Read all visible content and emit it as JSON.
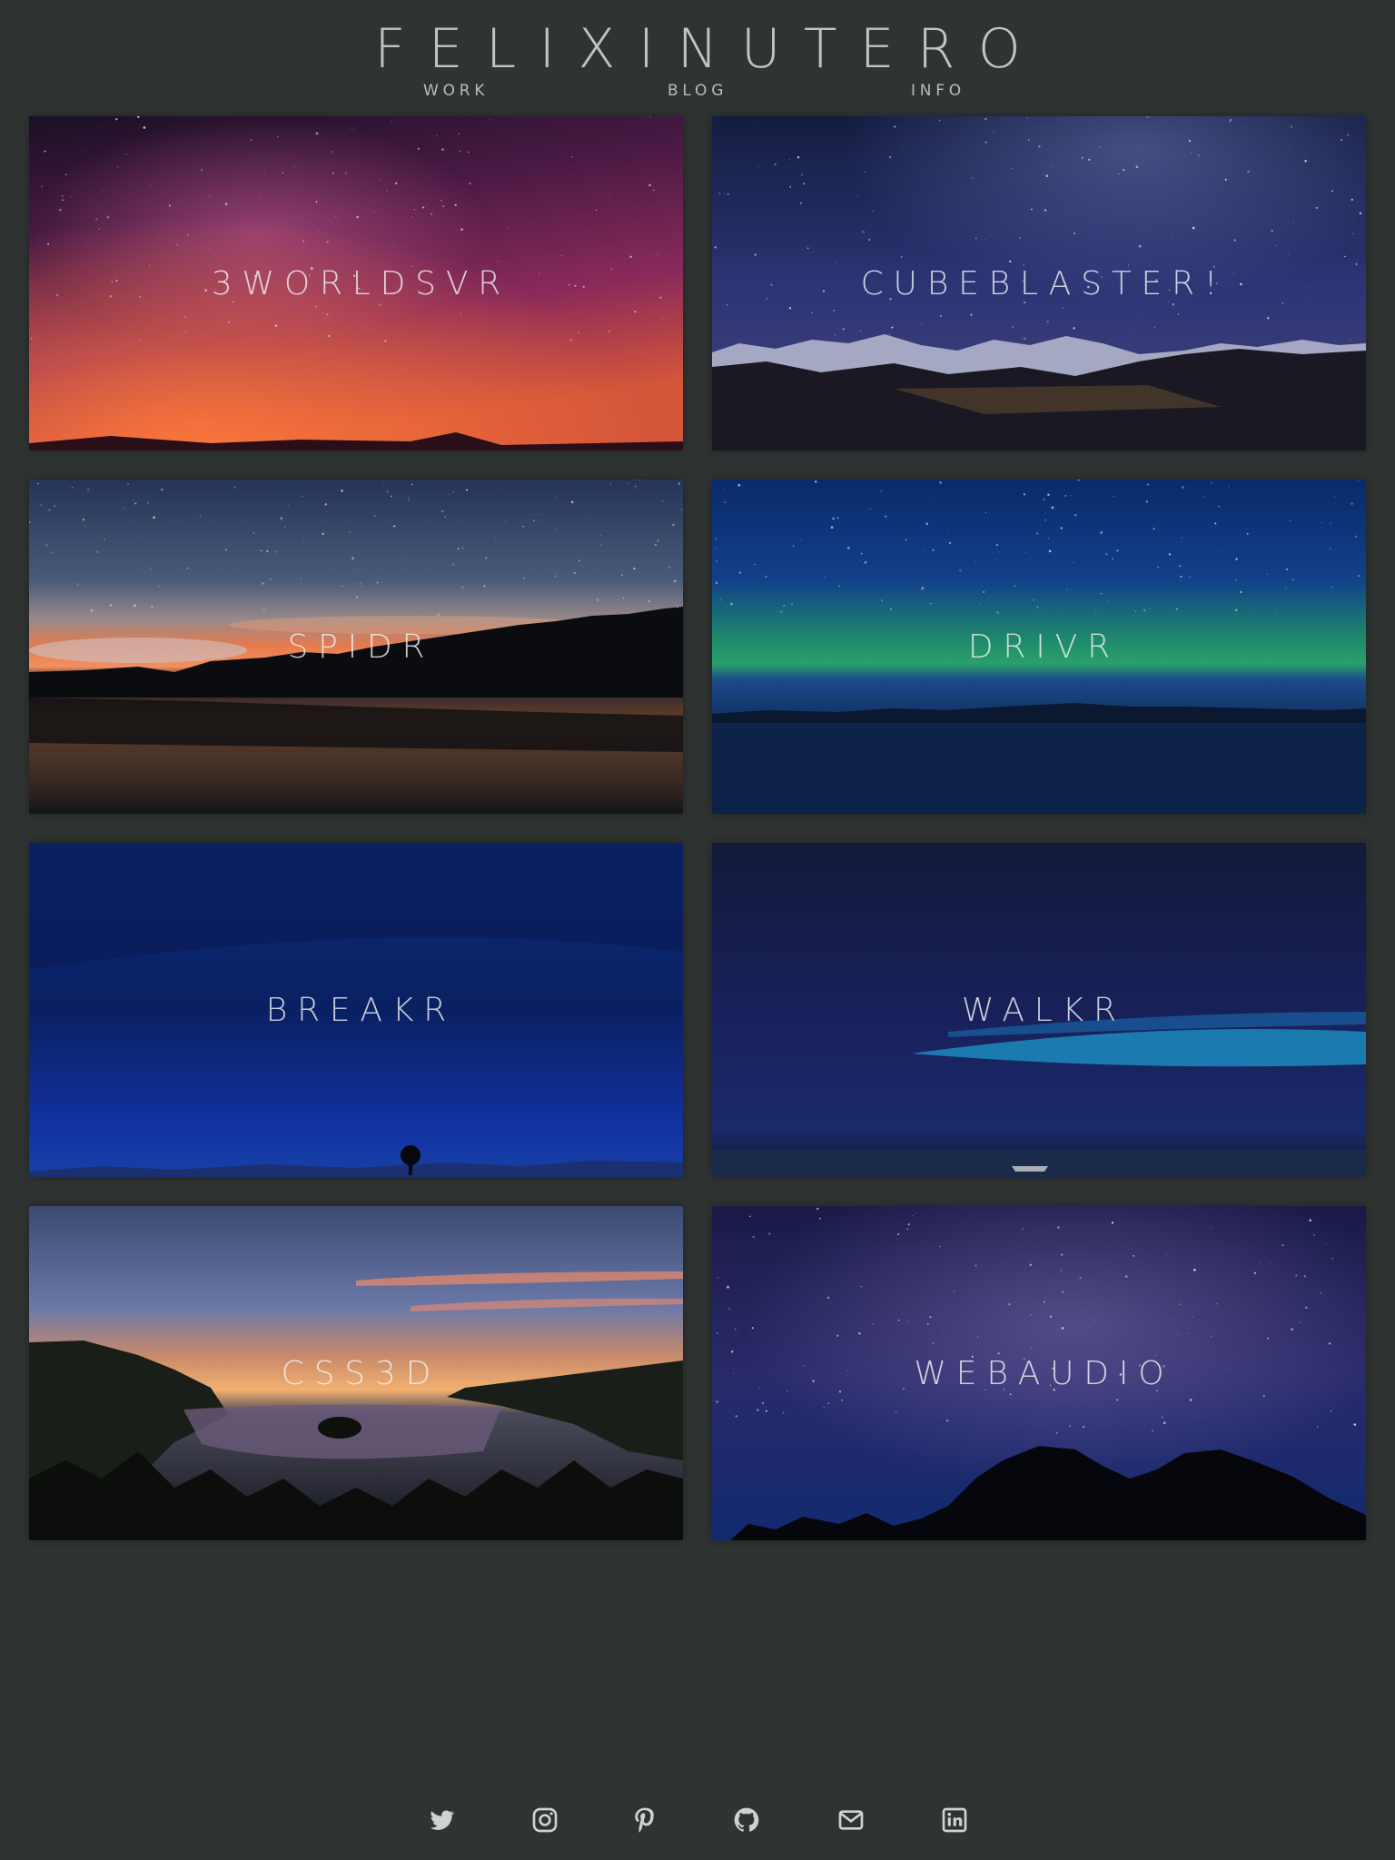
{
  "header": {
    "title": "FELIXINUTERO",
    "nav": [
      {
        "label": "WORK"
      },
      {
        "label": "BLOG"
      },
      {
        "label": "INFO"
      }
    ]
  },
  "projects": [
    {
      "label": "3WORLDSVR",
      "scene": "magenta-milky-way"
    },
    {
      "label": "CUBEBLASTER!",
      "scene": "starry-mountains"
    },
    {
      "label": "SPIDR",
      "scene": "sunset-lake"
    },
    {
      "label": "DRIVR",
      "scene": "aurora-lake"
    },
    {
      "label": "BREAKR",
      "scene": "blue-night-tree"
    },
    {
      "label": "WALKR",
      "scene": "blue-sky-water-boat"
    },
    {
      "label": "CSS3D",
      "scene": "dusk-emerald-bay"
    },
    {
      "label": "WEBAUDIO",
      "scene": "milky-way-trees"
    }
  ],
  "footer": {
    "icons": [
      "twitter-icon",
      "instagram-icon",
      "pinterest-icon",
      "github-icon",
      "email-icon",
      "linkedin-icon"
    ]
  },
  "colors": {
    "background": "#2f3433",
    "text": "#e8eaea",
    "nav_text": "#b7bcbc"
  }
}
